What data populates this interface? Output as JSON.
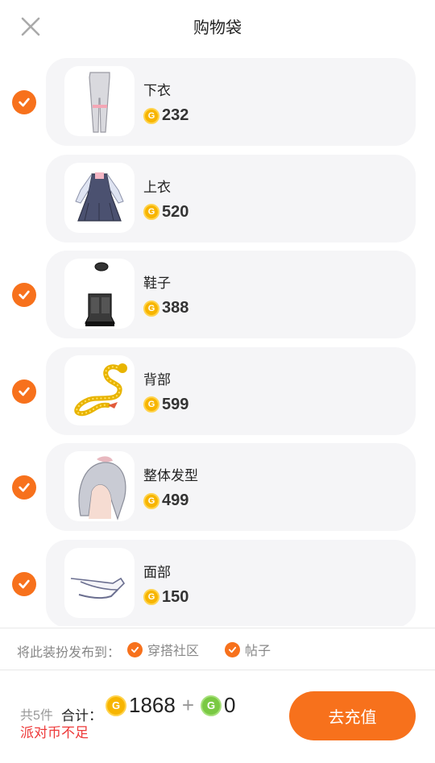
{
  "header": {
    "title": "购物袋",
    "close_icon": "close-icon"
  },
  "items": [
    {
      "name": "下衣",
      "price": "232",
      "checked": true,
      "thumb": "pants"
    },
    {
      "name": "上衣",
      "price": "520",
      "checked": false,
      "thumb": "dress"
    },
    {
      "name": "鞋子",
      "price": "388",
      "checked": true,
      "thumb": "boots"
    },
    {
      "name": "背部",
      "price": "599",
      "checked": true,
      "thumb": "dragon"
    },
    {
      "name": "整体发型",
      "price": "499",
      "checked": true,
      "thumb": "hair"
    },
    {
      "name": "面部",
      "price": "150",
      "checked": true,
      "thumb": "face"
    }
  ],
  "currency": {
    "gold_symbol": "G",
    "green_symbol": "G"
  },
  "publish": {
    "label": "将此装扮发布到：",
    "options": [
      {
        "label": "穿搭社区",
        "checked": true
      },
      {
        "label": "帖子",
        "checked": true
      }
    ]
  },
  "footer": {
    "count_text": "共5件",
    "total_label": "合计：",
    "gold_total": "1868",
    "plus": "+",
    "green_total": "0",
    "warning": "派对币不足",
    "recharge_label": "去充值"
  },
  "colors": {
    "accent": "#f7711c",
    "warning": "#ee3a3a",
    "gold": "#f7b500",
    "green": "#7ac943"
  }
}
